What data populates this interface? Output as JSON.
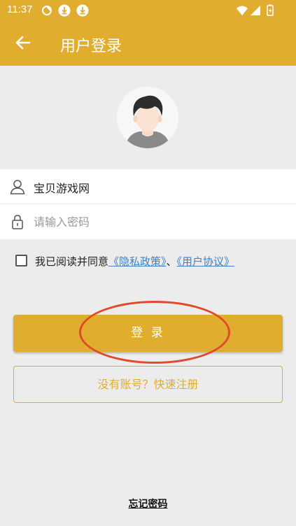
{
  "status_bar": {
    "time": "11:37"
  },
  "app_bar": {
    "title": "用户登录"
  },
  "form": {
    "username_value": "宝贝游戏网",
    "password_placeholder": "请输入密码"
  },
  "agreement": {
    "prefix": "我已阅读并同意",
    "privacy_link": "《隐私政策》",
    "separator": "、",
    "user_agreement_link": "《用户协议》"
  },
  "buttons": {
    "login": "登 录",
    "register": "没有账号？快速注册",
    "forgot_password": "忘记密码"
  },
  "colors": {
    "accent": "#e0ad2f",
    "link": "#3b82c8",
    "highlight": "#e04a2a",
    "background": "#ececec"
  },
  "icons": {
    "status": [
      "signal-icon",
      "download-icon",
      "download-icon",
      "wifi-icon",
      "cell-signal-icon",
      "battery-icon"
    ],
    "back": "arrow-left-icon",
    "user": "user-icon",
    "lock": "lock-icon"
  }
}
